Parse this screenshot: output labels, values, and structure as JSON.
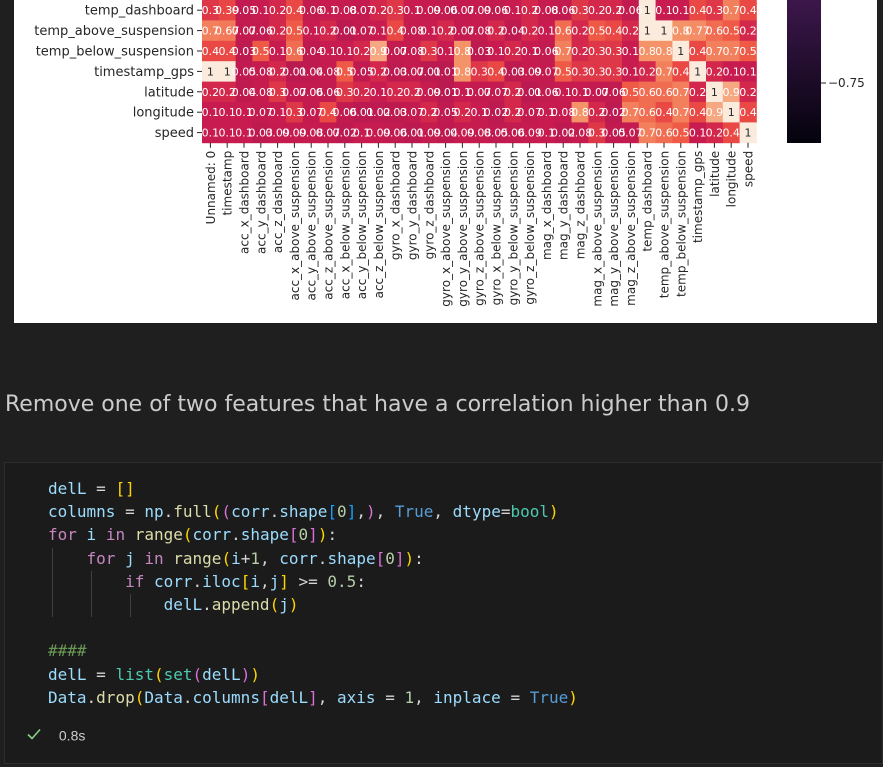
{
  "heatmap": {
    "row_labels": [
      "temp_dashboard",
      "temp_above_suspension",
      "temp_below_suspension",
      "timestamp_gps",
      "latitude",
      "longitude",
      "speed"
    ],
    "column_labels": [
      "Unnamed: 0",
      "timestamp",
      "acc_x_dashboard",
      "acc_y_dashboard",
      "acc_z_dashboard",
      "acc_x_above_suspension",
      "acc_y_above_suspension",
      "acc_z_above_suspension",
      "acc_x_below_suspension",
      "acc_y_below_suspension",
      "acc_z_below_suspension",
      "gyro_x_dashboard",
      "gyro_y_dashboard",
      "gyro_z_dashboard",
      "gyro_x_above_suspension",
      "gyro_y_above_suspension",
      "gyro_z_above_suspension",
      "gyro_x_below_suspension",
      "gyro_y_below_suspension",
      "gyro_z_below_suspension",
      "mag_x_dashboard",
      "mag_y_dashboard",
      "mag_z_dashboard",
      "mag_x_above_suspension",
      "mag_y_above_suspension",
      "mag_z_above_suspension",
      "temp_dashboard",
      "temp_above_suspension",
      "temp_below_suspension",
      "timestamp_gps",
      "latitude",
      "longitude",
      "speed"
    ],
    "cell_labels": [
      [
        "0.3",
        "0.39",
        "0.05",
        "0.1",
        "0.2",
        "0.4",
        "0.06",
        "0.1",
        "0.08",
        "0.07",
        "0.2",
        "0.3",
        "0.1",
        "0.09",
        "0.06",
        "0.07",
        "0.09",
        "0.06",
        "0.1",
        "0.2",
        "0.08",
        "0.06",
        "0.3",
        "0.2",
        "0.2",
        "0.06",
        "1",
        "0.1",
        "0.1",
        "0.4",
        "0.3",
        "0.7",
        "0.4"
      ],
      [
        "0.7",
        "0.67",
        "0.07",
        "0.06",
        "0.2",
        "0.5",
        "0.1",
        "0.2",
        "0.01",
        "0.07",
        "0.1",
        "0.4",
        "0.08",
        "0.1",
        "0.2",
        "0.07",
        "0.08",
        "0.2",
        "0.04",
        "0.2",
        "0.1",
        "0.6",
        "0.2",
        "0.5",
        "0.4",
        "0.2",
        "1",
        "1",
        "0.8",
        "0.77",
        "0.6",
        "0.5",
        "0.2"
      ],
      [
        "0.4",
        "0.4",
        "0.03",
        "0.5",
        "0.1",
        "0.6",
        "0.04",
        "0.1",
        "0.1",
        "0.2",
        "0.9",
        "0.07",
        "0.08",
        "0.3",
        "0.1",
        "0.8",
        "0.03",
        "0.1",
        "0.2",
        "0.1",
        "0.06",
        "0.7",
        "0.2",
        "0.3",
        "0.3",
        "0.1",
        "0.8",
        "0.8",
        "1",
        "0.4",
        "0.7",
        "0.7",
        "0.5"
      ],
      [
        "1",
        "1",
        "0.05",
        "0.08",
        "0.2",
        "0.01",
        "0.04",
        "0.08",
        "0.5",
        "0.05",
        "0.2",
        "0.03",
        "0.07",
        "0.01",
        "0.01",
        "0.8",
        "0.3",
        "0.4",
        "0.03",
        "0.09",
        "0.07",
        "0.5",
        "0.3",
        "0.3",
        "0.3",
        "0.1",
        "0.2",
        "0.7",
        "0.4",
        "1",
        "0.2",
        "0.1",
        "0.1"
      ],
      [
        "0.2",
        "0.2",
        "0.04",
        "0.08",
        "0.3",
        "0.07",
        "0.06",
        "0.06",
        "0.3",
        "0.2",
        "0.1",
        "0.2",
        "0.2",
        "0.09",
        "0.01",
        "0.1",
        "0.07",
        "0.07",
        "0.2",
        "0.01",
        "0.06",
        "0.1",
        "0.1",
        "0.07",
        "0.06",
        "0.5",
        "0.6",
        "0.6",
        "0.7",
        "0.2",
        "1",
        "0.9",
        "0.2"
      ],
      [
        "0.1",
        "0.1",
        "0.1",
        "0.07",
        "0.1",
        "0.3",
        "0.07",
        "0.4",
        "0.06",
        "0.01",
        "0.02",
        "0.03",
        "0.07",
        "0.2",
        "0.05",
        "0.2",
        "0.1",
        "0.02",
        "0.2",
        "0.07",
        "0.1",
        "0.08",
        "0.8",
        "0.2",
        "0.02",
        "0.7",
        "0.6",
        "0.4",
        "0.7",
        "0.4",
        "0.9",
        "1",
        "0.4"
      ],
      [
        "0.1",
        "0.1",
        "0.1",
        "0.03",
        "0.09",
        "0.09",
        "0.08",
        "0.07",
        "0.02",
        "0.1",
        "0.09",
        "0.06",
        "0.01",
        "0.09",
        "0.04",
        "0.09",
        "0.08",
        "0.05",
        "0.06",
        "0.09",
        "0.1",
        "0.02",
        "0.08",
        "0.3",
        "0.05",
        "0.07",
        "0.7",
        "0.6",
        "0.5",
        "0.1",
        "0.2",
        "0.4",
        "1"
      ]
    ],
    "colorbar_ticks": [
      "−0.75"
    ],
    "colors": {
      "colormap": "rocket",
      "diagonal": "#faebdd",
      "cell_text_dark": "#262626",
      "cell_text_light": "#ffffff"
    }
  },
  "markdown": {
    "text": "Remove one of two features that have a correlation higher than 0.9"
  },
  "code": {
    "lines": [
      [
        {
          "t": "delL",
          "c": "var"
        },
        {
          "t": " = ",
          "c": "op"
        },
        {
          "t": "[]",
          "c": "b1"
        }
      ],
      [
        {
          "t": "columns",
          "c": "var"
        },
        {
          "t": " = ",
          "c": "op"
        },
        {
          "t": "np",
          "c": "var"
        },
        {
          "t": ".",
          "c": "op"
        },
        {
          "t": "full",
          "c": "fn"
        },
        {
          "t": "(",
          "c": "b1"
        },
        {
          "t": "(",
          "c": "b2"
        },
        {
          "t": "corr",
          "c": "var"
        },
        {
          "t": ".",
          "c": "op"
        },
        {
          "t": "shape",
          "c": "var"
        },
        {
          "t": "[",
          "c": "b3"
        },
        {
          "t": "0",
          "c": "num"
        },
        {
          "t": "]",
          "c": "b3"
        },
        {
          "t": ",",
          "c": "op"
        },
        {
          "t": ")",
          "c": "b2"
        },
        {
          "t": ", ",
          "c": "op"
        },
        {
          "t": "True",
          "c": "const"
        },
        {
          "t": ", ",
          "c": "op"
        },
        {
          "t": "dtype",
          "c": "var"
        },
        {
          "t": "=",
          "c": "op"
        },
        {
          "t": "bool",
          "c": "cls"
        },
        {
          "t": ")",
          "c": "b1"
        }
      ],
      [
        {
          "t": "for",
          "c": "kw"
        },
        {
          "t": " ",
          "c": "op"
        },
        {
          "t": "i",
          "c": "var"
        },
        {
          "t": " ",
          "c": "op"
        },
        {
          "t": "in",
          "c": "kw"
        },
        {
          "t": " ",
          "c": "op"
        },
        {
          "t": "range",
          "c": "fn"
        },
        {
          "t": "(",
          "c": "b1"
        },
        {
          "t": "corr",
          "c": "var"
        },
        {
          "t": ".",
          "c": "op"
        },
        {
          "t": "shape",
          "c": "var"
        },
        {
          "t": "[",
          "c": "b2"
        },
        {
          "t": "0",
          "c": "num"
        },
        {
          "t": "]",
          "c": "b2"
        },
        {
          "t": ")",
          "c": "b1"
        },
        {
          "t": ":",
          "c": "op"
        }
      ],
      [
        {
          "t": "    ",
          "c": "op"
        },
        {
          "t": "for",
          "c": "kw"
        },
        {
          "t": " ",
          "c": "op"
        },
        {
          "t": "j",
          "c": "var"
        },
        {
          "t": " ",
          "c": "op"
        },
        {
          "t": "in",
          "c": "kw"
        },
        {
          "t": " ",
          "c": "op"
        },
        {
          "t": "range",
          "c": "fn"
        },
        {
          "t": "(",
          "c": "b1"
        },
        {
          "t": "i",
          "c": "var"
        },
        {
          "t": "+",
          "c": "op"
        },
        {
          "t": "1",
          "c": "num"
        },
        {
          "t": ", ",
          "c": "op"
        },
        {
          "t": "corr",
          "c": "var"
        },
        {
          "t": ".",
          "c": "op"
        },
        {
          "t": "shape",
          "c": "var"
        },
        {
          "t": "[",
          "c": "b2"
        },
        {
          "t": "0",
          "c": "num"
        },
        {
          "t": "]",
          "c": "b2"
        },
        {
          "t": ")",
          "c": "b1"
        },
        {
          "t": ":",
          "c": "op"
        }
      ],
      [
        {
          "t": "        ",
          "c": "op"
        },
        {
          "t": "if",
          "c": "kw"
        },
        {
          "t": " ",
          "c": "op"
        },
        {
          "t": "corr",
          "c": "var"
        },
        {
          "t": ".",
          "c": "op"
        },
        {
          "t": "iloc",
          "c": "var"
        },
        {
          "t": "[",
          "c": "b1"
        },
        {
          "t": "i",
          "c": "var"
        },
        {
          "t": ",",
          "c": "op"
        },
        {
          "t": "j",
          "c": "var"
        },
        {
          "t": "]",
          "c": "b1"
        },
        {
          "t": " >= ",
          "c": "op"
        },
        {
          "t": "0.5",
          "c": "num"
        },
        {
          "t": ":",
          "c": "op"
        }
      ],
      [
        {
          "t": "            ",
          "c": "op"
        },
        {
          "t": "delL",
          "c": "var"
        },
        {
          "t": ".",
          "c": "op"
        },
        {
          "t": "append",
          "c": "fn"
        },
        {
          "t": "(",
          "c": "b1"
        },
        {
          "t": "j",
          "c": "var"
        },
        {
          "t": ")",
          "c": "b1"
        }
      ],
      [],
      [
        {
          "t": "####",
          "c": "cmt"
        }
      ],
      [
        {
          "t": "delL",
          "c": "var"
        },
        {
          "t": " = ",
          "c": "op"
        },
        {
          "t": "list",
          "c": "cls"
        },
        {
          "t": "(",
          "c": "b1"
        },
        {
          "t": "set",
          "c": "cls"
        },
        {
          "t": "(",
          "c": "b2"
        },
        {
          "t": "delL",
          "c": "var"
        },
        {
          "t": ")",
          "c": "b2"
        },
        {
          "t": ")",
          "c": "b1"
        }
      ],
      [
        {
          "t": "Data",
          "c": "var"
        },
        {
          "t": ".",
          "c": "op"
        },
        {
          "t": "drop",
          "c": "fn"
        },
        {
          "t": "(",
          "c": "b1"
        },
        {
          "t": "Data",
          "c": "var"
        },
        {
          "t": ".",
          "c": "op"
        },
        {
          "t": "columns",
          "c": "var"
        },
        {
          "t": "[",
          "c": "b2"
        },
        {
          "t": "delL",
          "c": "var"
        },
        {
          "t": "]",
          "c": "b2"
        },
        {
          "t": ", ",
          "c": "op"
        },
        {
          "t": "axis",
          "c": "var"
        },
        {
          "t": " = ",
          "c": "op"
        },
        {
          "t": "1",
          "c": "num"
        },
        {
          "t": ", ",
          "c": "op"
        },
        {
          "t": "inplace",
          "c": "var"
        },
        {
          "t": " = ",
          "c": "op"
        },
        {
          "t": "True",
          "c": "const"
        },
        {
          "t": ")",
          "c": "b1"
        }
      ]
    ],
    "status": {
      "icon": "check-icon",
      "time": "0.8s",
      "success_color": "#89d185"
    }
  }
}
